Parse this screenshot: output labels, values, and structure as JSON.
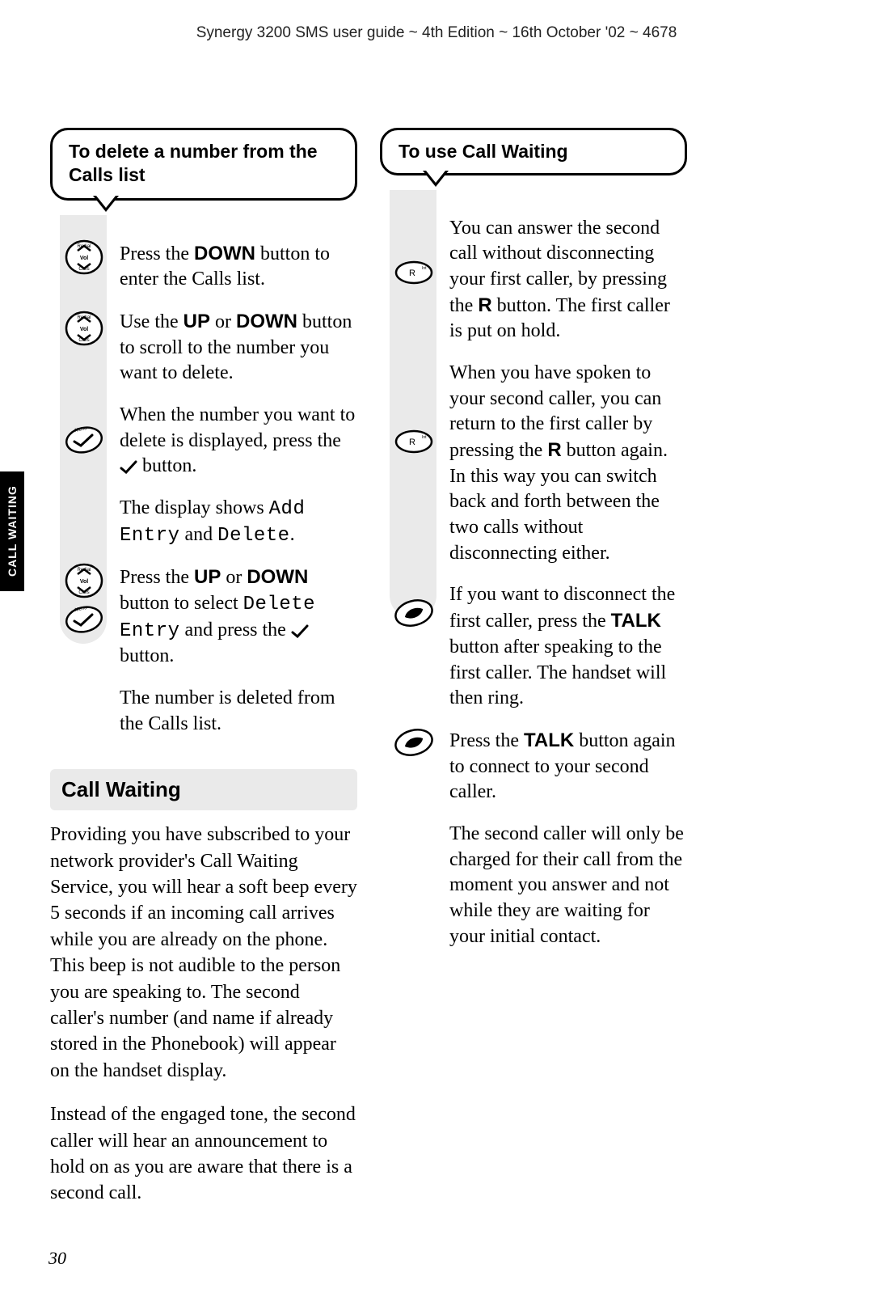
{
  "header": "Synergy 3200 SMS user guide ~ 4th Edition ~ 16th October '02 ~ 4678",
  "sideTab": "CALL WAITING",
  "pageNumber": "30",
  "left": {
    "calloutTitle": "To delete a number from the Calls list",
    "step1_a": "Press the ",
    "step1_b": "DOWN",
    "step1_c": " button to enter the Calls list.",
    "step2_a": "Use the ",
    "step2_b": "UP",
    "step2_c": " or ",
    "step2_d": "DOWN",
    "step2_e": " button to scroll to the number you want to delete.",
    "step3_a": "When the number you want to delete is displayed, press the ",
    "step3_b": " button.",
    "step4_a": "The display shows ",
    "step4_b": "Add Entry",
    "step4_c": " and ",
    "step4_d": "Delete",
    "step4_e": ".",
    "step5_a": "Press the ",
    "step5_b": "UP",
    "step5_c": " or ",
    "step5_d": "DOWN",
    "step5_e": " button to select ",
    "step5_f": "Delete Entry",
    "step5_g": " and press the ",
    "step5_h": " button.",
    "step6": "The number is deleted from the Calls list.",
    "sectionHeading": "Call Waiting",
    "para1": "Providing you have subscribed to your network provider's Call Waiting Service, you will hear a soft beep every 5 seconds if an incoming call arrives while you are already on the phone. This beep is not audible to the person you are speaking to. The second caller's number (and name if already stored in the Phonebook) will appear on the handset display.",
    "para2": "Instead of the engaged tone, the second caller will hear an announcement to hold on as you are aware that there is a second call."
  },
  "right": {
    "calloutTitle": "To use Call Waiting",
    "p1_a": "You can answer the second call without disconnecting your first caller, by pressing the ",
    "p1_b": "R",
    "p1_c": " button. The first caller is put on hold.",
    "p2_a": "When you have spoken to your second caller, you can return to the first caller by pressing the ",
    "p2_b": "R",
    "p2_c": " button again. In this way you can switch back and forth between the two calls without disconnecting either.",
    "p3_a": "If you want to disconnect the first caller, press the ",
    "p3_b": "TALK",
    "p3_c": " button after speaking to the first caller. The handset will then ring.",
    "p4_a": "Press the ",
    "p4_b": "TALK",
    "p4_c": " button again to connect to your second caller.",
    "p5": "The second caller will only be charged for their call from the moment you answer and not while they are waiting for your initial contact."
  },
  "icons": {
    "volRedialCalls": "Redial/Vol/Calls",
    "menuCheck": "Menu",
    "rInt": "R / Int",
    "talk": "Talk"
  }
}
